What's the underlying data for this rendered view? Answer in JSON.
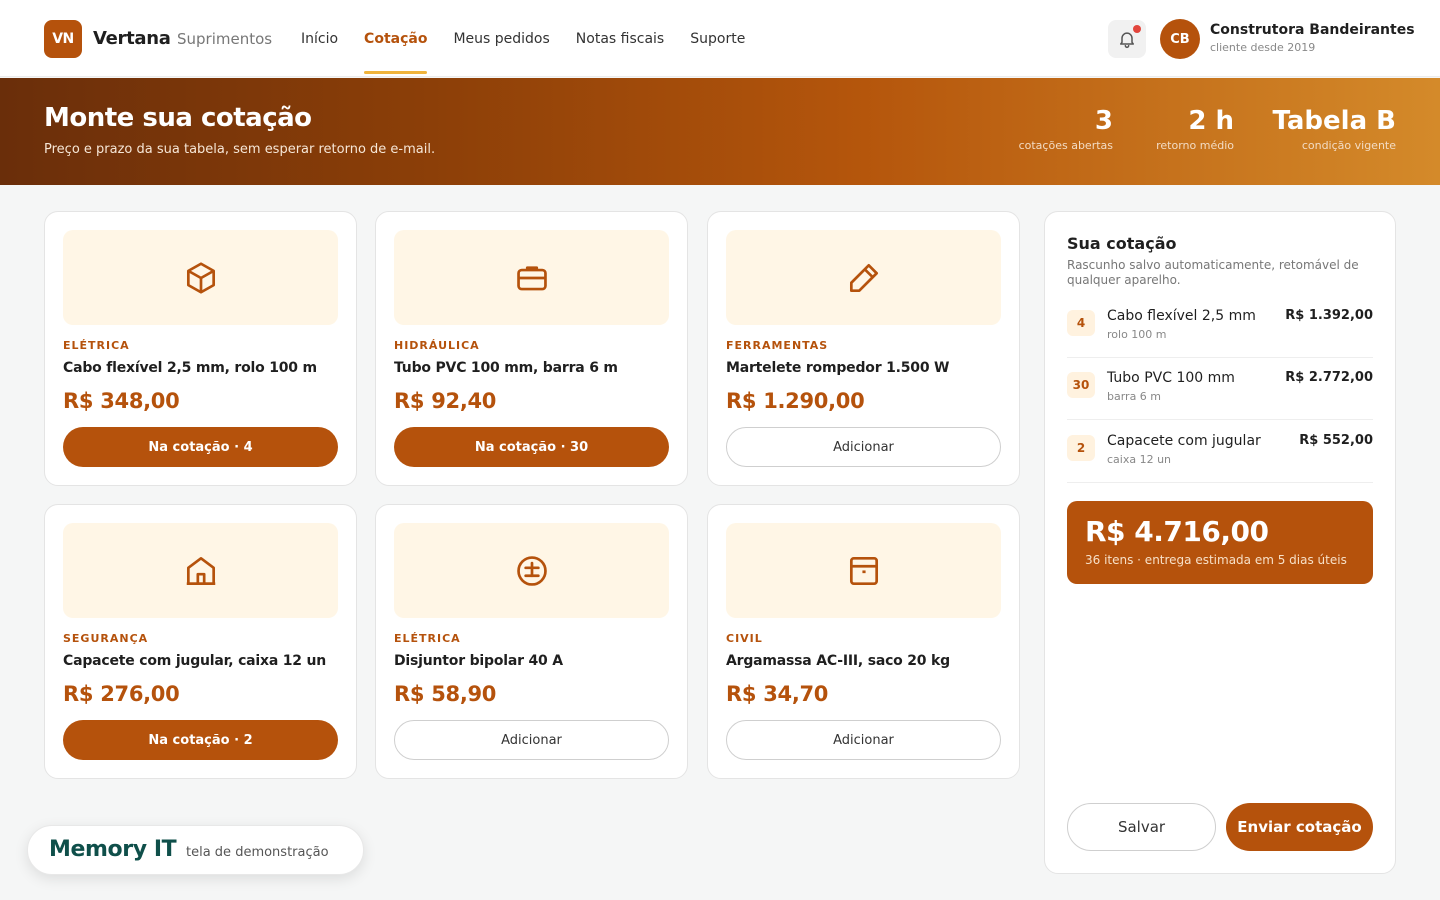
{
  "brand": {
    "logo": "VN",
    "name": "Vertana",
    "sub": "Suprimentos"
  },
  "nav": [
    {
      "label": "Início",
      "active": false
    },
    {
      "label": "Cotação",
      "active": true
    },
    {
      "label": "Meus pedidos",
      "active": false
    },
    {
      "label": "Notas fiscais",
      "active": false
    },
    {
      "label": "Suporte",
      "active": false
    }
  ],
  "user": {
    "initials": "CB",
    "name": "Construtora Bandeirantes",
    "since": "cliente desde 2019"
  },
  "hero": {
    "title": "Monte sua cotação",
    "subtitle": "Preço e prazo da sua tabela, sem esperar retorno de e-mail.",
    "stats": [
      {
        "value": "3",
        "label": "cotações abertas"
      },
      {
        "value": "2 h",
        "label": "retorno médio"
      },
      {
        "value": "Tabela B",
        "label": "condição vigente"
      }
    ]
  },
  "products": [
    {
      "icon": "box-icon",
      "category": "ELÉTRICA",
      "name": "Cabo flexível 2,5 mm, rolo 100 m",
      "price": "R$ 348,00",
      "button": "Na cotação · 4",
      "in_quote": true
    },
    {
      "icon": "briefcase-icon",
      "category": "HIDRÁULICA",
      "name": "Tubo PVC 100 mm, barra 6 m",
      "price": "R$ 92,40",
      "button": "Na cotação · 30",
      "in_quote": true
    },
    {
      "icon": "pencil-icon",
      "category": "FERRAMENTAS",
      "name": "Martelete rompedor 1.500 W",
      "price": "R$ 1.290,00",
      "button": "Adicionar",
      "in_quote": false
    },
    {
      "icon": "house-icon",
      "category": "SEGURANÇA",
      "name": "Capacete com jugular, caixa 12 un",
      "price": "R$ 276,00",
      "button": "Na cotação · 2",
      "in_quote": true
    },
    {
      "icon": "circle-plus-minus-icon",
      "category": "ELÉTRICA",
      "name": "Disjuntor bipolar 40 A",
      "price": "R$ 58,90",
      "button": "Adicionar",
      "in_quote": false
    },
    {
      "icon": "archive-box-icon",
      "category": "CIVIL",
      "name": "Argamassa AC-III, saco 20 kg",
      "price": "R$ 34,70",
      "button": "Adicionar",
      "in_quote": false
    }
  ],
  "quote": {
    "title": "Sua cotação",
    "subtitle": "Rascunho salvo automaticamente, retomável de qualquer aparelho.",
    "items": [
      {
        "qty": "4",
        "name": "Cabo flexível 2,5 mm",
        "detail": "rolo 100 m",
        "price": "R$ 1.392,00"
      },
      {
        "qty": "30",
        "name": "Tubo PVC 100 mm",
        "detail": "barra 6 m",
        "price": "R$ 2.772,00"
      },
      {
        "qty": "2",
        "name": "Capacete com jugular",
        "detail": "caixa 12 un",
        "price": "R$ 552,00"
      }
    ],
    "total": "R$ 4.716,00",
    "total_note": "36 itens · entrega estimada em 5 dias úteis",
    "save_label": "Salvar",
    "send_label": "Enviar cotação"
  },
  "watermark": {
    "brand": "Memory IT",
    "sub": "tela de demonstração"
  },
  "colors": {
    "accent": "#b5520c",
    "accent_light": "#fff6e6",
    "highlight": "#f0b43c",
    "notification": "#e2453c",
    "watermark_brand": "#0f4f4a"
  }
}
